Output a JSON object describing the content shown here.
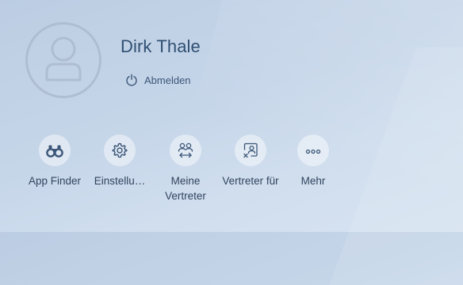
{
  "user": {
    "name": "Dirk Thale",
    "logout_label": "Abmelden"
  },
  "actions": [
    {
      "label": "App Finder",
      "icon": "binoculars-icon"
    },
    {
      "label": "Einstellu…",
      "icon": "gear-icon"
    },
    {
      "label": "Meine\nVertreter",
      "icon": "substitutes-icon"
    },
    {
      "label": "Vertreter für",
      "icon": "substitute-for-icon"
    },
    {
      "label": "Mehr",
      "icon": "more-icon"
    }
  ],
  "colors": {
    "name": "#2f4f73",
    "icon": "#3b5678",
    "label": "#32455e"
  }
}
